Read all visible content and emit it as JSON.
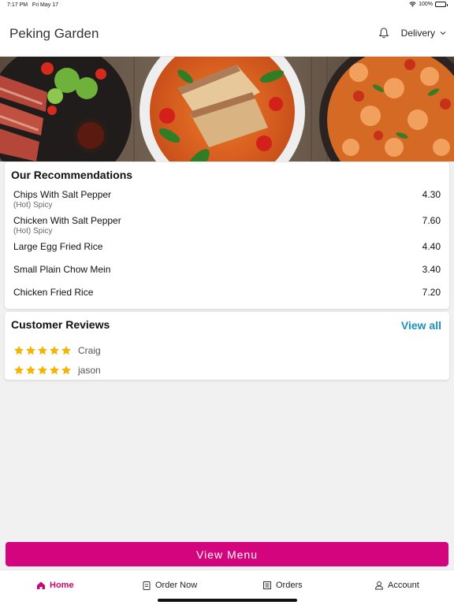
{
  "status_bar": {
    "time": "7:17 PM",
    "date": "Fri May 17",
    "battery": "100%"
  },
  "header": {
    "title": "Peking Garden",
    "delivery_label": "Delivery"
  },
  "recommendations": {
    "title": "Our Recommendations",
    "items": [
      {
        "name": "Chips With Salt Pepper",
        "note": "(Hot) Spicy",
        "price": "4.30"
      },
      {
        "name": "Chicken With Salt Pepper",
        "note": "(Hot) Spicy",
        "price": "7.60"
      },
      {
        "name": "Large Egg Fried Rice",
        "note": "",
        "price": "4.40"
      },
      {
        "name": "Small Plain Chow Mein",
        "note": "",
        "price": "3.40"
      },
      {
        "name": "Chicken Fried Rice",
        "note": "",
        "price": "7.20"
      }
    ]
  },
  "reviews": {
    "title": "Customer Reviews",
    "view_all": "View all",
    "items": [
      {
        "name": "Craig",
        "rating": 5
      },
      {
        "name": "jason",
        "rating": 5
      }
    ]
  },
  "view_menu_label": "View Menu",
  "tabs": [
    {
      "label": "Home",
      "icon": "home-icon",
      "active": true
    },
    {
      "label": "Order Now",
      "icon": "clipboard-icon",
      "active": false
    },
    {
      "label": "Orders",
      "icon": "receipt-icon",
      "active": false
    },
    {
      "label": "Account",
      "icon": "user-icon",
      "active": false
    }
  ],
  "colors": {
    "brand": "#d4047f",
    "link": "#1b8fc2",
    "star": "#f5b400"
  }
}
